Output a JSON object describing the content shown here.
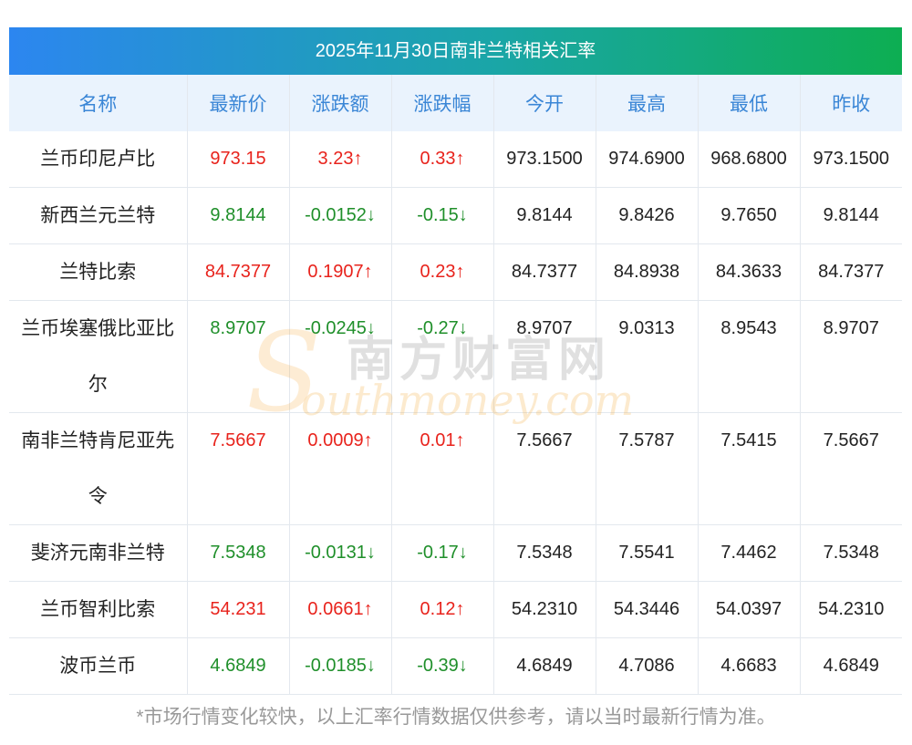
{
  "title": "2025年11月30日南非兰特相关汇率",
  "headers": [
    "名称",
    "最新价",
    "涨跌额",
    "涨跌幅",
    "今开",
    "最高",
    "最低",
    "昨收"
  ],
  "rows": [
    {
      "name": "兰币印尼卢比",
      "latest": "973.15",
      "change": "3.23↑",
      "pct": "0.33↑",
      "open": "973.1500",
      "high": "974.6900",
      "low": "968.6800",
      "prev": "973.1500",
      "dir": "up"
    },
    {
      "name": "新西兰元兰特",
      "latest": "9.8144",
      "change": "-0.0152↓",
      "pct": "-0.15↓",
      "open": "9.8144",
      "high": "9.8426",
      "low": "9.7650",
      "prev": "9.8144",
      "dir": "down"
    },
    {
      "name": "兰特比索",
      "latest": "84.7377",
      "change": "0.1907↑",
      "pct": "0.23↑",
      "open": "84.7377",
      "high": "84.8938",
      "low": "84.3633",
      "prev": "84.7377",
      "dir": "up"
    },
    {
      "name": "兰币埃塞俄比亚比尔",
      "latest": "8.9707",
      "change": "-0.0245↓",
      "pct": "-0.27↓",
      "open": "8.9707",
      "high": "9.0313",
      "low": "8.9543",
      "prev": "8.9707",
      "dir": "down"
    },
    {
      "name": "南非兰特肯尼亚先令",
      "latest": "7.5667",
      "change": "0.0009↑",
      "pct": "0.01↑",
      "open": "7.5667",
      "high": "7.5787",
      "low": "7.5415",
      "prev": "7.5667",
      "dir": "up"
    },
    {
      "name": "斐济元南非兰特",
      "latest": "7.5348",
      "change": "-0.0131↓",
      "pct": "-0.17↓",
      "open": "7.5348",
      "high": "7.5541",
      "low": "7.4462",
      "prev": "7.5348",
      "dir": "down"
    },
    {
      "name": "兰币智利比索",
      "latest": "54.231",
      "change": "0.0661↑",
      "pct": "0.12↑",
      "open": "54.2310",
      "high": "54.3446",
      "low": "54.0397",
      "prev": "54.2310",
      "dir": "up"
    },
    {
      "name": "波币兰币",
      "latest": "4.6849",
      "change": "-0.0185↓",
      "pct": "-0.39↓",
      "open": "4.6849",
      "high": "4.7086",
      "low": "4.6683",
      "prev": "4.6849",
      "dir": "down"
    }
  ],
  "watermark": {
    "cn": "南方财富网",
    "en": "outhmoney.com",
    "s": "S"
  },
  "footer": "*市场行情变化较快，以上汇率行情数据仅供参考，请以当时最新行情为准。",
  "colors": {
    "up": "#e8231c",
    "down": "#1f8f2a",
    "header_text": "#3a86d6",
    "header_bg": "#eaf3fd"
  }
}
